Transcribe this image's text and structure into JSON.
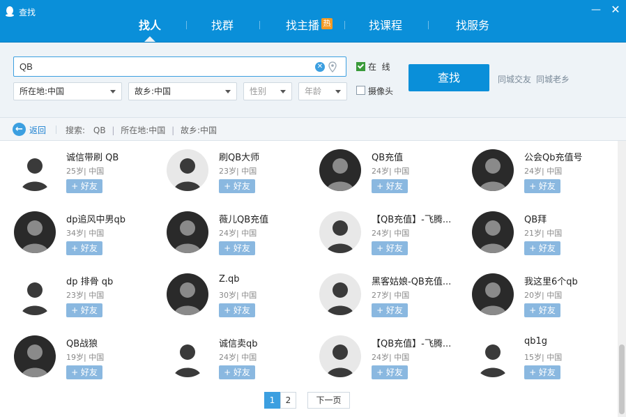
{
  "window": {
    "title": "查找",
    "min_glyph": "—",
    "close_glyph": "✕"
  },
  "tabs": [
    {
      "label": "找人",
      "active": true
    },
    {
      "label": "找群",
      "active": false
    },
    {
      "label": "找主播",
      "active": false,
      "badge": "热"
    },
    {
      "label": "找课程",
      "active": false
    },
    {
      "label": "找服务",
      "active": false
    }
  ],
  "search": {
    "query": "QB",
    "location": "所在地:中国",
    "hometown": "故乡:中国",
    "gender": "性别",
    "age": "年龄",
    "online_label": "在  线",
    "online_checked": true,
    "camera_label": "摄像头",
    "camera_checked": false,
    "find_button": "查找",
    "link_city_friends": "同城交友",
    "link_city_hometown": "同城老乡"
  },
  "breadcrumb": {
    "back_label": "返回",
    "prefix": "搜索:",
    "query": "QB",
    "location": "所在地:中国",
    "hometown": "故乡:中国"
  },
  "add_label": "+ 好友",
  "results": [
    {
      "name": "诚信带刷 QB",
      "age": "25岁",
      "region": "中国"
    },
    {
      "name": "刷QB大师",
      "age": "23岁",
      "region": "中国"
    },
    {
      "name": "QB充值",
      "age": "24岁",
      "region": "中国"
    },
    {
      "name": "公会Qb充值号",
      "age": "24岁",
      "region": "中国"
    },
    {
      "name": "dp追风中男qb",
      "age": "34岁",
      "region": "中国"
    },
    {
      "name": "薇儿QB充值",
      "age": "24岁",
      "region": "中国"
    },
    {
      "name": "【QB充值】-飞腾...",
      "age": "24岁",
      "region": "中国"
    },
    {
      "name": "QB拜",
      "age": "21岁",
      "region": "中国"
    },
    {
      "name": "dp 排骨 qb",
      "age": "23岁",
      "region": "中国"
    },
    {
      "name": "Z.qb",
      "age": "30岁",
      "region": "中国"
    },
    {
      "name": "黑客姑娘-QB充值...",
      "age": "27岁",
      "region": "中国"
    },
    {
      "name": "我这里6个qb",
      "age": "20岁",
      "region": "中国"
    },
    {
      "name": "QB战狼",
      "age": "19岁",
      "region": "中国"
    },
    {
      "name": "诚信卖qb",
      "age": "24岁",
      "region": "中国"
    },
    {
      "name": "【QB充值】-飞腾...",
      "age": "24岁",
      "region": "中国"
    },
    {
      "name": "qb1g",
      "age": "15岁",
      "region": "中国"
    }
  ],
  "pagination": {
    "pages": [
      "1",
      "2"
    ],
    "current": "1",
    "next_label": "下一页"
  }
}
